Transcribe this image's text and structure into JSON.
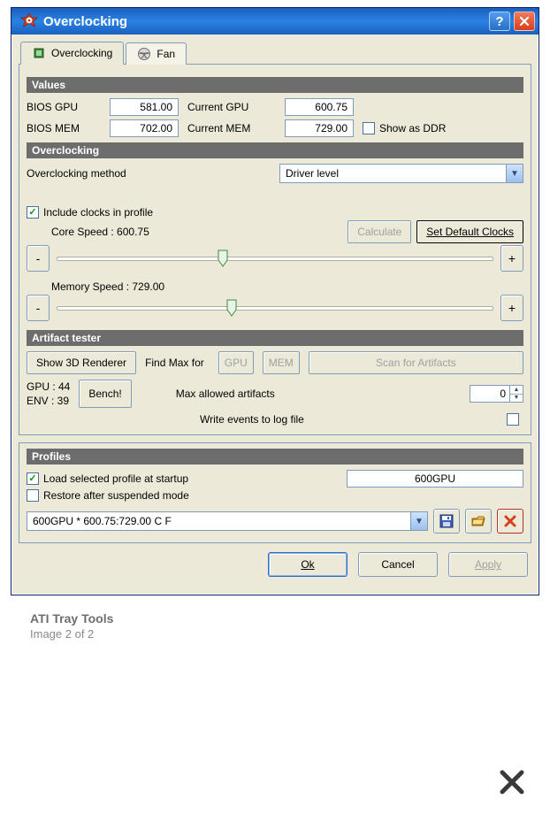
{
  "window": {
    "title": "Overclocking"
  },
  "tabs": {
    "overclocking": "Overclocking",
    "fan": "Fan"
  },
  "sections": {
    "values": "Values",
    "overclocking": "Overclocking",
    "artifact": "Artifact tester",
    "profiles": "Profiles"
  },
  "values": {
    "bios_gpu_lbl": "BIOS GPU",
    "bios_gpu_val": "581.00",
    "bios_mem_lbl": "BIOS MEM",
    "bios_mem_val": "702.00",
    "cur_gpu_lbl": "Current GPU",
    "cur_gpu_val": "600.75",
    "cur_mem_lbl": "Current MEM",
    "cur_mem_val": "729.00",
    "show_ddr": "Show as DDR"
  },
  "oc": {
    "method_lbl": "Overclocking method",
    "method_val": "Driver level",
    "include_lbl": "Include clocks in profile",
    "core_lbl": "Core Speed : 600.75",
    "mem_lbl": "Memory Speed : 729.00",
    "calc_btn": "Calculate",
    "setdef_btn": "Set Default Clocks",
    "minus": "-",
    "plus": "+"
  },
  "artifact": {
    "show3d": "Show 3D Renderer",
    "findmax": "Find Max for",
    "gpu": "GPU",
    "mem": "MEM",
    "scan": "Scan for Artifacts",
    "gpu_temp": "GPU : 44",
    "env_temp": "ENV : 39",
    "bench": "Bench!",
    "maxart_lbl": "Max allowed artifacts",
    "maxart_val": "0",
    "writelog": "Write events to log file"
  },
  "profiles": {
    "load_startup": "Load selected profile at startup",
    "restore": "Restore after suspended mode",
    "current_name": "600GPU",
    "combo": "600GPU * 600.75:729.00 C  F"
  },
  "footer": {
    "ok": "Ok",
    "cancel": "Cancel",
    "apply": "Apply"
  },
  "caption": {
    "title": "ATI Tray Tools",
    "sub": "Image 2 of 2"
  }
}
